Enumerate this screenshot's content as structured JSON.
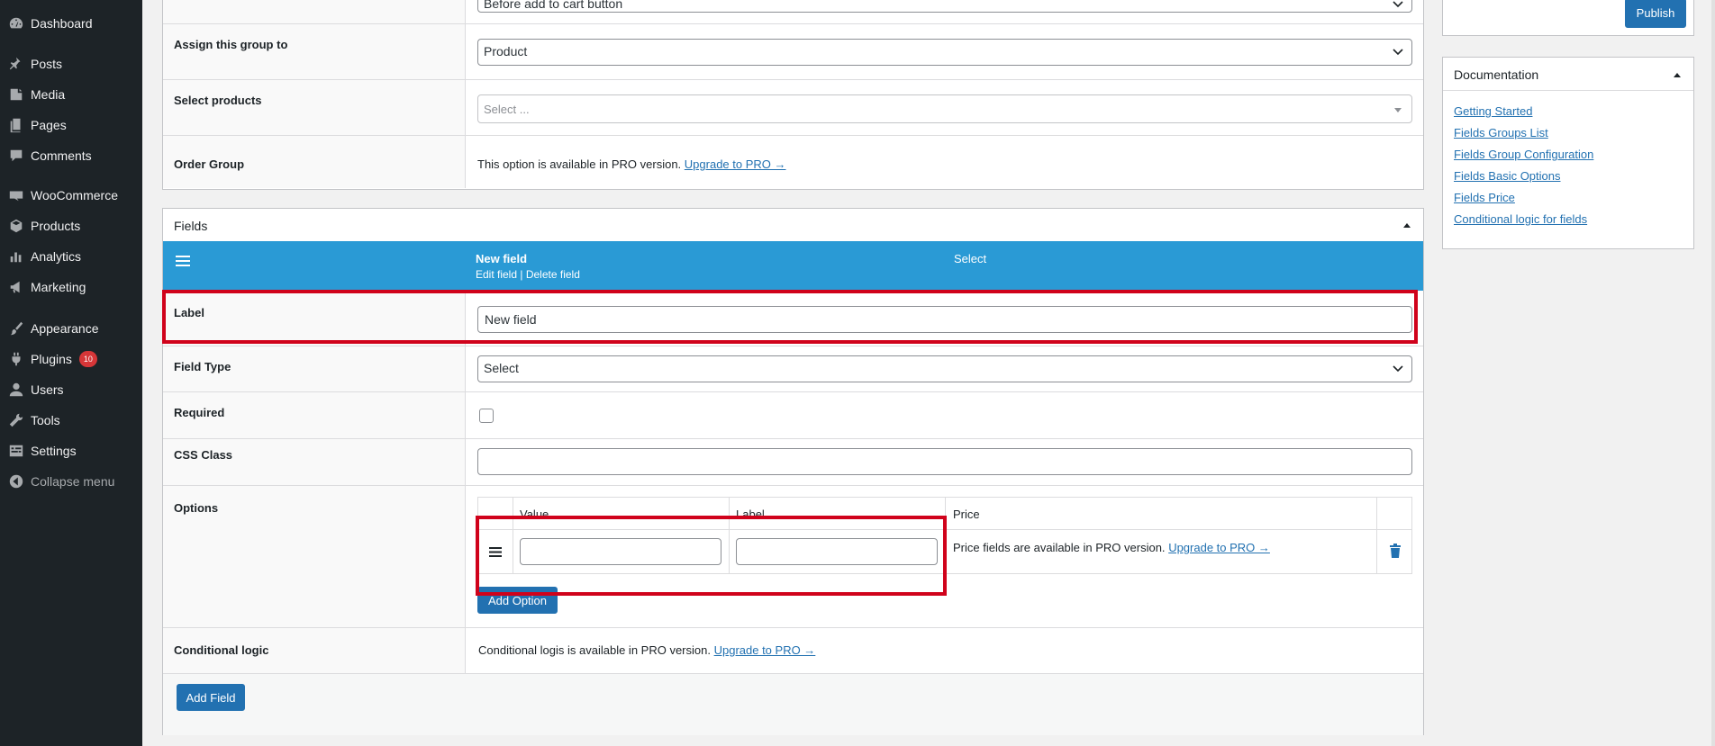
{
  "sidebar": {
    "items": [
      {
        "label": "Dashboard",
        "icon": "dashboard-icon"
      },
      {
        "label": "Posts",
        "icon": "pin-icon"
      },
      {
        "label": "Media",
        "icon": "media-icon"
      },
      {
        "label": "Pages",
        "icon": "pages-icon"
      },
      {
        "label": "Comments",
        "icon": "comment-icon"
      },
      {
        "label": "WooCommerce",
        "icon": "woo-icon"
      },
      {
        "label": "Products",
        "icon": "box-icon"
      },
      {
        "label": "Analytics",
        "icon": "bar-chart-icon"
      },
      {
        "label": "Marketing",
        "icon": "megaphone-icon"
      },
      {
        "label": "Appearance",
        "icon": "brush-icon"
      },
      {
        "label": "Plugins",
        "icon": "plug-icon",
        "badge": "10"
      },
      {
        "label": "Users",
        "icon": "user-icon"
      },
      {
        "label": "Tools",
        "icon": "wrench-icon"
      },
      {
        "label": "Settings",
        "icon": "settings-icon"
      },
      {
        "label": "Collapse menu",
        "icon": "collapse-icon"
      }
    ]
  },
  "group": {
    "top_select_value": "Before add to cart button",
    "assign_label": "Assign this group to",
    "assign_value": "Product",
    "select_products_label": "Select products",
    "select_products_placeholder": "Select ...",
    "order_group_label": "Order Group",
    "order_group_text": "This option is available in PRO version.",
    "upgrade_link": "Upgrade to PRO →"
  },
  "fields": {
    "title": "Fields",
    "header": {
      "field_name": "New field",
      "edit_link": "Edit field",
      "separator": "|",
      "delete_link": "Delete field",
      "field_type": "Select"
    },
    "label_label": "Label",
    "label_value": "New field",
    "field_type_label": "Field Type",
    "field_type_value": "Select",
    "required_label": "Required",
    "css_class_label": "CSS Class",
    "css_class_value": "",
    "options_label": "Options",
    "options_table": {
      "headers": {
        "value": "Value",
        "label": "Label",
        "price": "Price"
      },
      "row": {
        "value": "",
        "label": "",
        "price_text": "Price fields are available in PRO version.",
        "price_link": "Upgrade to PRO →"
      }
    },
    "add_option_button": "Add Option",
    "conditional_label": "Conditional logic",
    "conditional_text": "Conditional logis is available in PRO version.",
    "conditional_link": "Upgrade to PRO →",
    "add_field_button": "Add Field"
  },
  "publish": {
    "button": "Publish"
  },
  "documentation": {
    "title": "Documentation",
    "links": [
      "Getting Started",
      "Fields Groups List",
      "Fields Group Configuration",
      "Fields Basic Options",
      "Fields Price",
      "Conditional logic for fields"
    ]
  },
  "colors": {
    "sidebar_bg": "#1d2327",
    "primary": "#2271b1",
    "field_header_bg": "#2a9ad5",
    "highlight_red": "#d0021b",
    "badge": "#d63638"
  }
}
